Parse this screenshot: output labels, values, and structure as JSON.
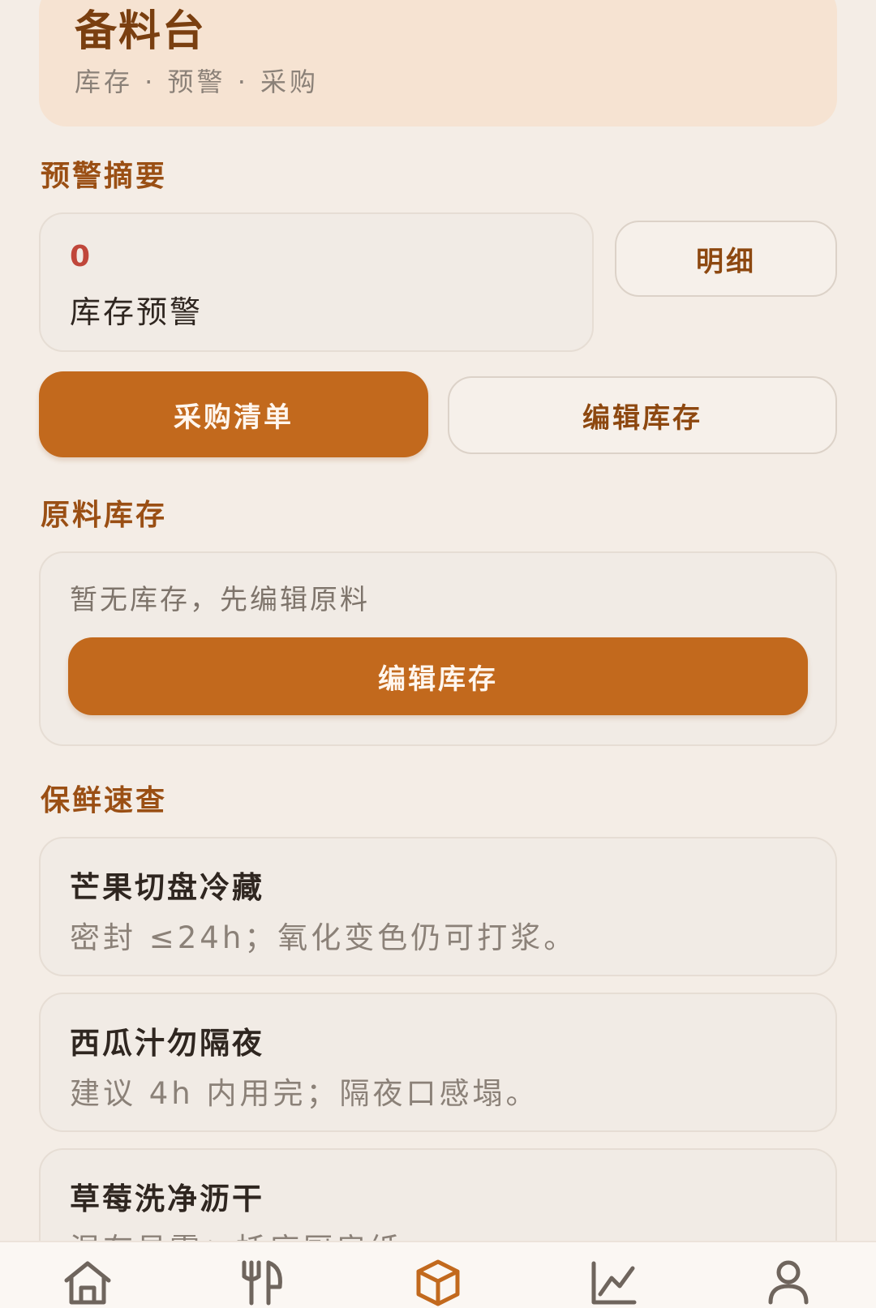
{
  "header": {
    "title": "备料台",
    "subtitle": "库存 · 预警 · 采购"
  },
  "alert_section": {
    "title": "预警摘要",
    "count": "0",
    "label": "库存预警",
    "detail_button": "明细",
    "purchase_button": "采购清单",
    "edit_button": "编辑库存"
  },
  "inventory_section": {
    "title": "原料库存",
    "empty_text": "暂无库存，先编辑原料",
    "edit_button": "编辑库存"
  },
  "freshness_section": {
    "title": "保鲜速查",
    "tips": [
      {
        "title": "芒果切盘冷藏",
        "desc": "密封 ≤24h；氧化变色仍可打浆。"
      },
      {
        "title": "西瓜汁勿隔夜",
        "desc": "建议 4h 内用完；隔夜口感塌。"
      },
      {
        "title": "草莓洗净沥干",
        "desc": "湿存易霉；托底厨房纸"
      }
    ]
  },
  "bottom_nav": {
    "items": [
      {
        "icon": "home-icon",
        "active": false
      },
      {
        "icon": "utensils-icon",
        "active": false
      },
      {
        "icon": "box-icon",
        "active": true
      },
      {
        "icon": "chart-icon",
        "active": false
      },
      {
        "icon": "user-icon",
        "active": false
      }
    ],
    "active_color": "#c2691d",
    "inactive_color": "#6f655d"
  }
}
